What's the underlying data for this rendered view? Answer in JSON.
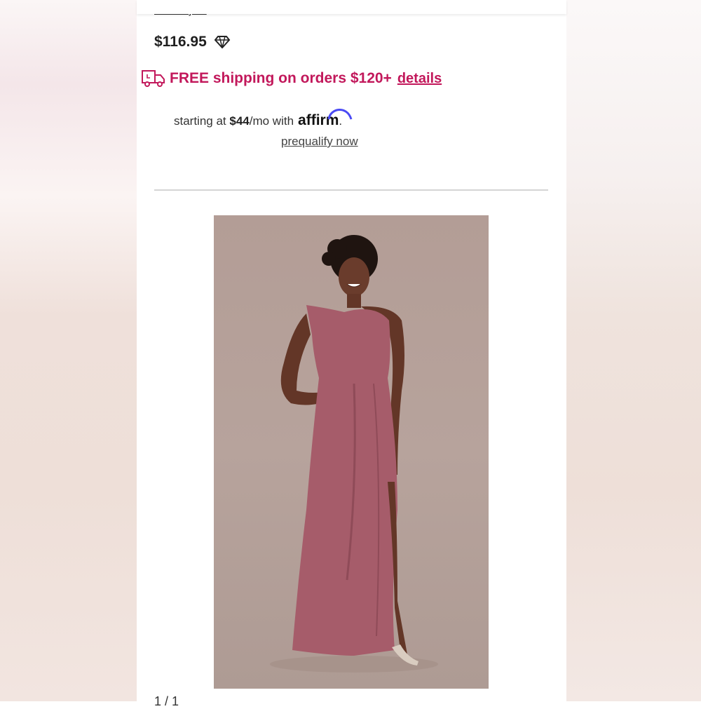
{
  "header": {
    "free_to_join": "free to join"
  },
  "product": {
    "price": "$116.95",
    "shipping_text": "FREE shipping on orders $120+",
    "shipping_details": "details",
    "affirm_prefix": "starting at ",
    "affirm_amount": "$44",
    "affirm_suffix": "/mo with",
    "affirm_brand": "affirm",
    "affirm_period": ".",
    "prequalify": "prequalify now",
    "image_counter": "1 / 1"
  },
  "colors": {
    "accent": "#c2185b",
    "dress": "#a65c6a",
    "backdrop": "#b39d96"
  },
  "icons": [
    "diamond-icon",
    "truck-icon"
  ]
}
